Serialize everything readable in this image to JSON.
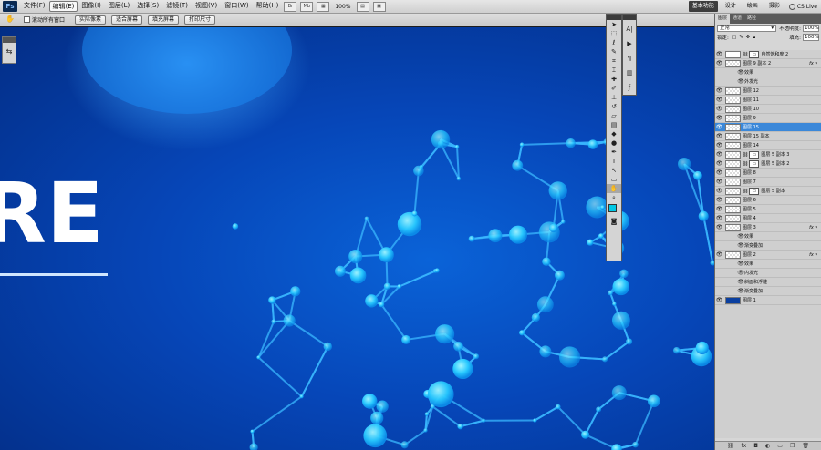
{
  "menubar": {
    "logo": "Ps",
    "items": [
      "文件(F)",
      "编辑(E)",
      "图像(I)",
      "图层(L)",
      "选择(S)",
      "滤镜(T)",
      "视图(V)",
      "窗口(W)",
      "帮助(H)"
    ],
    "selected_index": 1,
    "zoom": "100%",
    "workspaces": [
      "基本功能",
      "设计",
      "绘画",
      "摄影"
    ],
    "selected_workspace": 0,
    "cs_live": "CS Live"
  },
  "options_bar": {
    "scroll_all_windows": "滚动所有窗口",
    "buttons": [
      "实际像素",
      "适合屏幕",
      "填充屏幕",
      "打印尺寸"
    ]
  },
  "canvas": {
    "text": "RE",
    "colors": {
      "bg_dark": "#032d85",
      "bg_mid": "#0646b8",
      "node": "#2ad1ff",
      "node_dark": "#1b8cf0"
    }
  },
  "toolbox": {
    "tools": [
      "move-tool",
      "marquee-tool",
      "lasso-tool",
      "quick-select-tool",
      "crop-tool",
      "eyedropper-tool",
      "healing-tool",
      "brush-tool",
      "clone-stamp-tool",
      "history-brush-tool",
      "eraser-tool",
      "gradient-tool",
      "blur-tool",
      "dodge-tool",
      "pen-tool",
      "type-tool",
      "path-select-tool",
      "shape-tool",
      "hand-tool",
      "zoom-tool"
    ],
    "active_index": 18,
    "foreground_color": "#00c8e6",
    "background_color": "#5a1ea8"
  },
  "layers_panel": {
    "tabs": [
      "图层",
      "通道",
      "路径"
    ],
    "blend_mode": "正常",
    "opacity_label": "不透明度:",
    "opacity_value": "100%",
    "lock_label": "锁定:",
    "fill_label": "填充:",
    "fill_value": "100%",
    "rows": [
      {
        "name": "自然饱和度 2",
        "kind": "adjust",
        "fx": false,
        "sub": false,
        "sel": false
      },
      {
        "name": "图层 9 副本 2",
        "kind": "layer",
        "fx": true,
        "sub": false,
        "sel": false
      },
      {
        "name": "效果",
        "kind": "effect",
        "fx": false,
        "sub": true,
        "sel": false
      },
      {
        "name": "外发光",
        "kind": "effect",
        "fx": false,
        "sub": true,
        "sel": false
      },
      {
        "name": "图层 12",
        "kind": "layer",
        "fx": false,
        "sub": false,
        "sel": false
      },
      {
        "name": "图层 11",
        "kind": "layer",
        "fx": false,
        "sub": false,
        "sel": false
      },
      {
        "name": "图层 10",
        "kind": "layer",
        "fx": false,
        "sub": false,
        "sel": false
      },
      {
        "name": "图层 9",
        "kind": "layer",
        "fx": false,
        "sub": false,
        "sel": false
      },
      {
        "name": "图层 15",
        "kind": "layer",
        "fx": false,
        "sub": false,
        "sel": true
      },
      {
        "name": "图层 15 副本",
        "kind": "layer",
        "fx": false,
        "sub": false,
        "sel": false
      },
      {
        "name": "图层 14",
        "kind": "layer",
        "fx": false,
        "sub": false,
        "sel": false
      },
      {
        "name": "图层 5 副本 3",
        "kind": "masked",
        "fx": false,
        "sub": false,
        "sel": false
      },
      {
        "name": "图层 5 副本 2",
        "kind": "masked",
        "fx": false,
        "sub": false,
        "sel": false
      },
      {
        "name": "图层 8",
        "kind": "layer",
        "fx": false,
        "sub": false,
        "sel": false
      },
      {
        "name": "图层 7",
        "kind": "layer",
        "fx": false,
        "sub": false,
        "sel": false
      },
      {
        "name": "图层 5 副本",
        "kind": "masked",
        "fx": false,
        "sub": false,
        "sel": false
      },
      {
        "name": "图层 6",
        "kind": "layer",
        "fx": false,
        "sub": false,
        "sel": false
      },
      {
        "name": "图层 5",
        "kind": "layer",
        "fx": false,
        "sub": false,
        "sel": false
      },
      {
        "name": "图层 4",
        "kind": "layer",
        "fx": false,
        "sub": false,
        "sel": false
      },
      {
        "name": "图层 3",
        "kind": "layer",
        "fx": true,
        "sub": false,
        "sel": false
      },
      {
        "name": "效果",
        "kind": "effect",
        "fx": false,
        "sub": true,
        "sel": false
      },
      {
        "name": "渐变叠加",
        "kind": "effect",
        "fx": false,
        "sub": true,
        "sel": false
      },
      {
        "name": "图层 2",
        "kind": "layer",
        "fx": true,
        "sub": false,
        "sel": false
      },
      {
        "name": "效果",
        "kind": "effect",
        "fx": false,
        "sub": true,
        "sel": false
      },
      {
        "name": "内发光",
        "kind": "effect",
        "fx": false,
        "sub": true,
        "sel": false
      },
      {
        "name": "斜面和浮雕",
        "kind": "effect",
        "fx": false,
        "sub": true,
        "sel": false
      },
      {
        "name": "渐变叠加",
        "kind": "effect",
        "fx": false,
        "sub": true,
        "sel": false
      },
      {
        "name": "图层 1",
        "kind": "image",
        "fx": false,
        "sub": false,
        "sel": false
      }
    ]
  }
}
